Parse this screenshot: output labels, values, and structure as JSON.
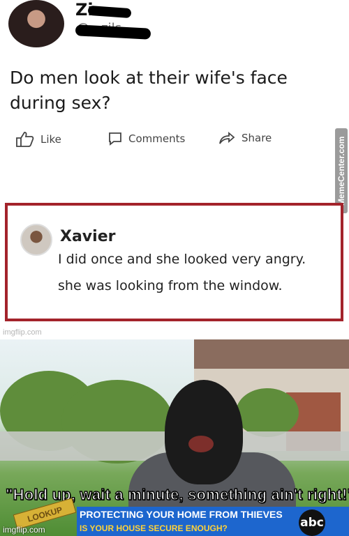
{
  "post": {
    "name_visible": "Zi",
    "handle_visible": "@...zils",
    "question": "Do men look at their wife's face during sex?",
    "actions": {
      "like": "Like",
      "comments": "Comments",
      "share": "Share"
    }
  },
  "watermarks": {
    "side": "MemeCenter.com",
    "top_imgflip": "imgflip.com",
    "bottom_imgflip": "imgflip.com"
  },
  "reply": {
    "name": "Xavier",
    "line1": "I did once and she looked very angry.",
    "line2": "she was looking from the window."
  },
  "video": {
    "caption": "\"Hold up, wait a minute, something ain't right!\"",
    "lookup_tag": "LOOKUP",
    "headline": "PROTECTING YOUR HOME FROM THIEVES",
    "subhead": "IS YOUR HOUSE SECURE ENOUGH?",
    "network_logo": "abc"
  }
}
